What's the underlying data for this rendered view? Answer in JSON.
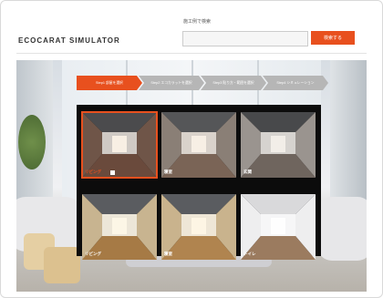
{
  "header": {
    "logo": "ECOCARAT SIMULATOR",
    "search_label": "施工例で検索",
    "search_value": "",
    "search_button": "検索する"
  },
  "colors": {
    "accent": "#e8501e",
    "step_inactive": "#b6b6b6",
    "panel_bg": "#0c0c0c"
  },
  "steps": [
    {
      "label": "Step1 部屋を選択",
      "active": true
    },
    {
      "label": "Step2 エコカラットを選択",
      "active": false
    },
    {
      "label": "Step3 貼り方・範囲を選択",
      "active": false
    },
    {
      "label": "Step4 シミュレーション",
      "active": false
    }
  ],
  "rooms": [
    {
      "label": "リビング",
      "variant": "living-gray",
      "selected": true
    },
    {
      "label": "寝室",
      "variant": "bedroom-gray",
      "selected": false
    },
    {
      "label": "玄関",
      "variant": "entry-gray",
      "selected": false
    },
    {
      "label": "リビング",
      "variant": "living-wood",
      "selected": false
    },
    {
      "label": "寝室",
      "variant": "bedroom-wood",
      "selected": false
    },
    {
      "label": "トイレ",
      "variant": "toilet-white",
      "selected": false
    }
  ]
}
